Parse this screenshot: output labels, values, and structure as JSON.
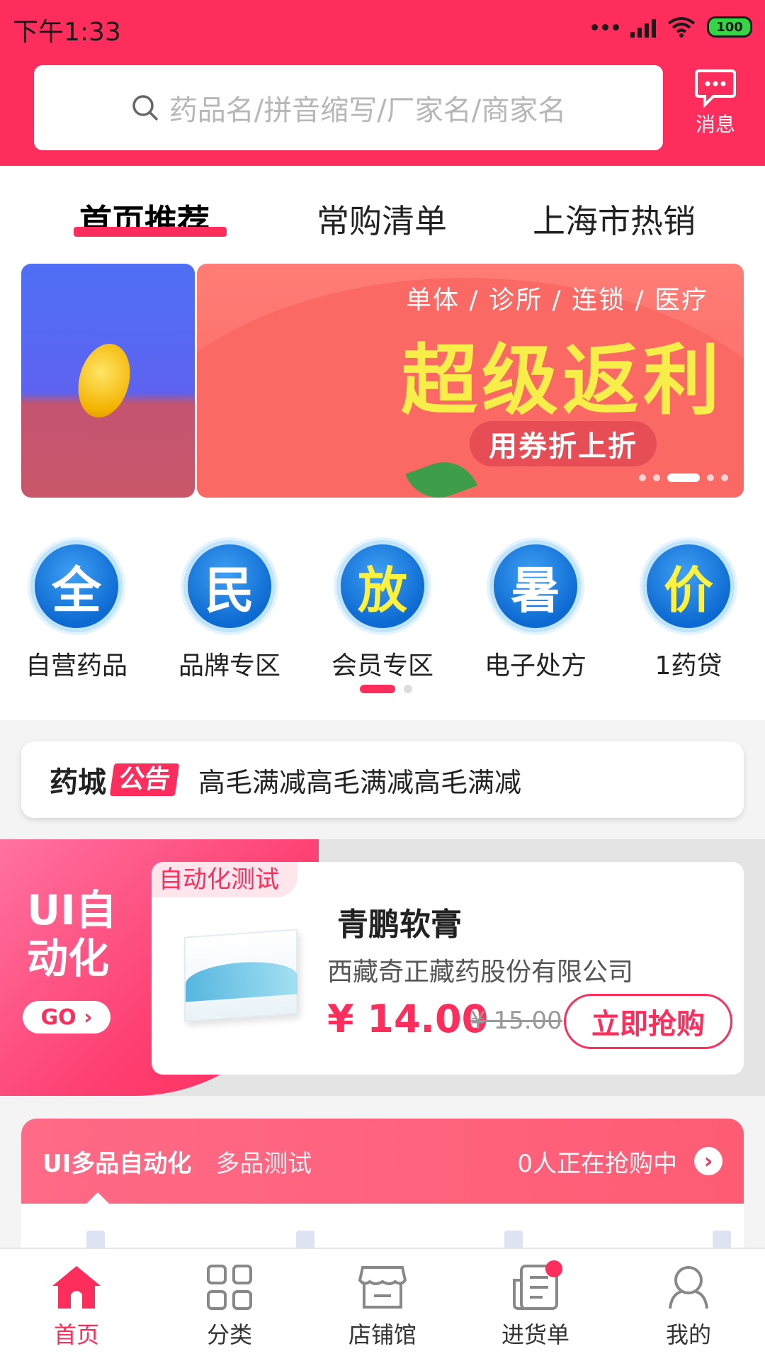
{
  "status_bar": {
    "time": "下午1:33",
    "battery": "100"
  },
  "search": {
    "placeholder": "药品名/拼音缩写/厂家名/商家名"
  },
  "header": {
    "message_label": "消息"
  },
  "tabs": [
    {
      "label": "首页推荐",
      "active": true
    },
    {
      "label": "常购清单",
      "active": false
    },
    {
      "label": "上海市热销",
      "active": false
    }
  ],
  "banner": {
    "subtitle": "单体 / 诊所 / 连锁 / 医疗",
    "title": "超级返利",
    "pill": "用券折上折",
    "slide_count": 6,
    "active_slide": 3
  },
  "categories": [
    {
      "icon_char": "全",
      "label": "自营药品"
    },
    {
      "icon_char": "民",
      "label": "品牌专区"
    },
    {
      "icon_char": "放",
      "label": "会员专区"
    },
    {
      "icon_char": "暑",
      "label": "电子处方"
    },
    {
      "icon_char": "价",
      "label": "1药贷"
    }
  ],
  "notice": {
    "logo": "药城",
    "tag": "公告",
    "text": "高毛满减高毛满减高毛满减"
  },
  "promo": {
    "side_title": "UI自动化",
    "go_label": "GO ›",
    "tag": "自动化测试",
    "product_name": "青鹏软膏",
    "company": "西藏奇正藏药股份有限公司",
    "price": "¥ 14.00",
    "old_price": "¥ 15.00",
    "buy_label": "立即抢购"
  },
  "multi": {
    "title": "UI多品自动化",
    "subtitle": "多品测试",
    "count_text": "0人正在抢购中",
    "arrow": "›"
  },
  "bottom_nav": [
    {
      "label": "首页",
      "icon": "home-icon",
      "active": true
    },
    {
      "label": "分类",
      "icon": "grid-icon",
      "active": false
    },
    {
      "label": "店铺馆",
      "icon": "store-icon",
      "active": false
    },
    {
      "label": "进货单",
      "icon": "order-list-icon",
      "active": false,
      "badge": true
    },
    {
      "label": "我的",
      "icon": "user-icon",
      "active": false
    }
  ],
  "colors": {
    "brand": "#fe2d5c",
    "banner_yellow": "#f7ee4a",
    "category_blue": "#0d6ad2"
  }
}
